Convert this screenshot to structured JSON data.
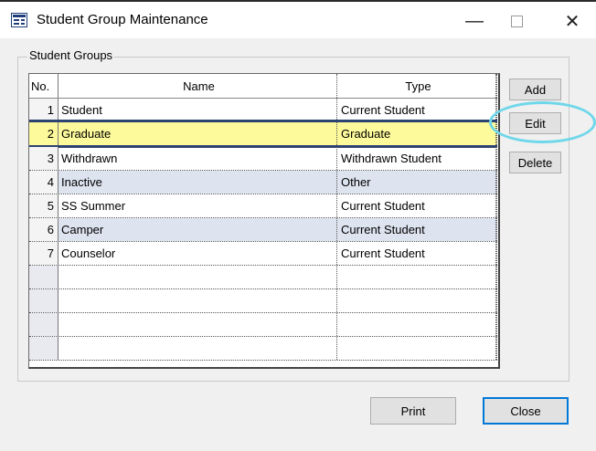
{
  "window": {
    "title": "Student Group Maintenance",
    "minimize_glyph": "—",
    "close_glyph": "✕"
  },
  "groupbox": {
    "label": "Student Groups"
  },
  "table": {
    "columns": [
      "No.",
      "Name",
      "Type"
    ],
    "rows": [
      {
        "no": "1",
        "name": "Student",
        "type": "Current Student"
      },
      {
        "no": "2",
        "name": "Graduate",
        "type": "Graduate"
      },
      {
        "no": "3",
        "name": "Withdrawn",
        "type": "Withdrawn Student"
      },
      {
        "no": "4",
        "name": "Inactive",
        "type": "Other"
      },
      {
        "no": "5",
        "name": "SS Summer",
        "type": "Current Student"
      },
      {
        "no": "6",
        "name": "Camper",
        "type": "Current Student"
      },
      {
        "no": "7",
        "name": "Counselor",
        "type": "Current Student"
      }
    ],
    "selected_row": 2
  },
  "buttons": {
    "add": "Add",
    "edit": "Edit",
    "delete": "Delete",
    "print": "Print",
    "close": "Close"
  },
  "colors": {
    "selected_row": "#fdfa9b",
    "alt_row": "#dde3ef",
    "highlight_ring": "#6fd7ea"
  }
}
